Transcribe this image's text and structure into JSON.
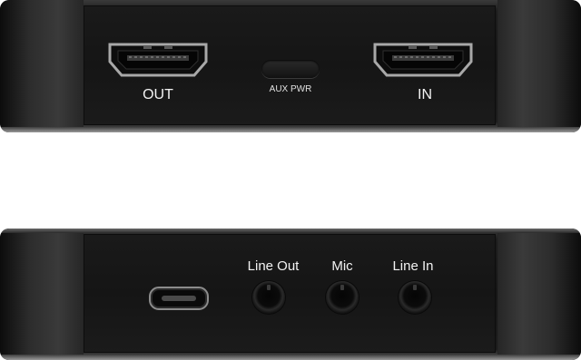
{
  "top_panel": {
    "hdmi_out_label": "OUT",
    "aux_label": "AUX PWR",
    "hdmi_in_label": "IN"
  },
  "bottom_panel": {
    "line_out_label": "Line Out",
    "mic_label": "Mic",
    "line_in_label": "Line In"
  },
  "colors": {
    "device_body": "#161616",
    "label_text": "#f2f2f2",
    "background": "#ffffff"
  },
  "icons": [
    "hdmi-port-icon",
    "usb-c-port-icon",
    "audio-jack-icon"
  ]
}
